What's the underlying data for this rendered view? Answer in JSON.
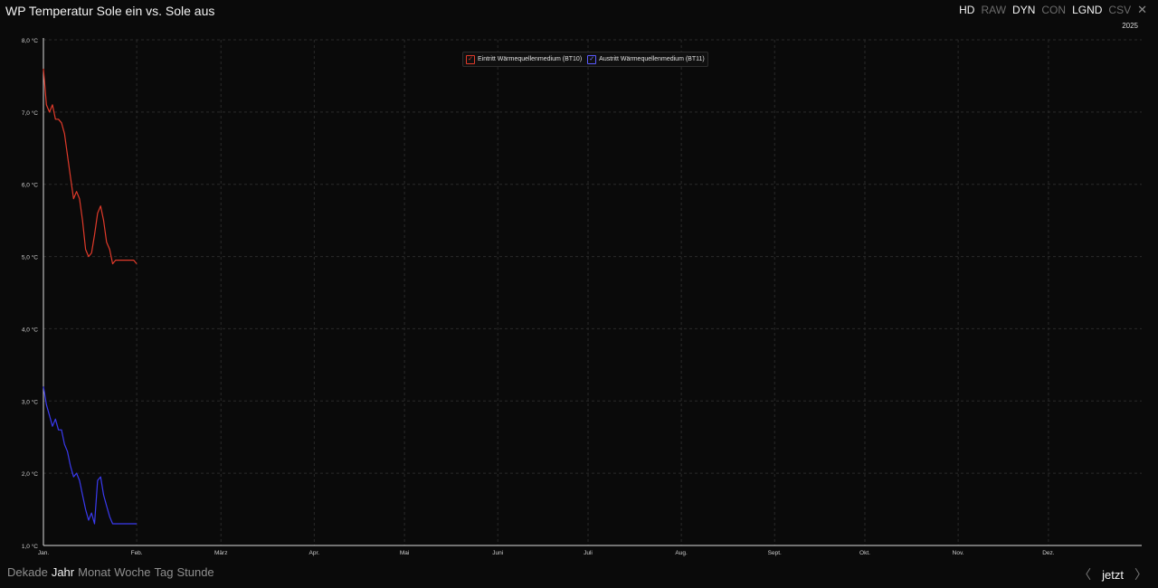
{
  "header": {
    "title": "WP Temperatur Sole ein vs. Sole aus",
    "toolbar": [
      {
        "label": "HD",
        "active": true
      },
      {
        "label": "RAW",
        "active": false
      },
      {
        "label": "DYN",
        "active": true
      },
      {
        "label": "CON",
        "active": false
      },
      {
        "label": "LGND",
        "active": true
      },
      {
        "label": "CSV",
        "active": false
      }
    ],
    "close_icon": "close-icon",
    "year": "2025"
  },
  "legend": [
    {
      "label": "Eintritt Wärmequellenmedium (BT10)",
      "color": "#e03a2a",
      "checked": true
    },
    {
      "label": "Austritt Wärmequellenmedium (BT11)",
      "color": "#3a3af0",
      "checked": true
    }
  ],
  "chart_data": {
    "type": "line",
    "ylim": [
      1.0,
      8.0
    ],
    "y_ticks": [
      "1,0 °C",
      "2,0 °C",
      "3,0 °C",
      "4,0 °C",
      "5,0 °C",
      "6,0 °C",
      "7,0 °C",
      "8,0 °C"
    ],
    "x_ticks": [
      "Jan.",
      "Feb.",
      "März",
      "Apr.",
      "Mai",
      "Juni",
      "Juli",
      "Aug.",
      "Sept.",
      "Okt.",
      "Nov.",
      "Dez."
    ],
    "x_unit": "day of year",
    "grid": true,
    "legend_position": "top-center",
    "series": [
      {
        "name": "Eintritt Wärmequellenmedium (BT10)",
        "color": "#e03a2a",
        "x": [
          1,
          2,
          3,
          4,
          5,
          6,
          7,
          8,
          9,
          10,
          11,
          12,
          13,
          14,
          15,
          16,
          17,
          18,
          19,
          20,
          21,
          22,
          23,
          24,
          25,
          26,
          27,
          28,
          29,
          30,
          31,
          32
        ],
        "y": [
          7.6,
          7.1,
          7.0,
          7.1,
          6.9,
          6.9,
          6.85,
          6.7,
          6.4,
          6.1,
          5.8,
          5.9,
          5.8,
          5.5,
          5.1,
          5.0,
          5.05,
          5.3,
          5.6,
          5.7,
          5.5,
          5.2,
          5.1,
          4.9,
          4.95,
          4.95,
          4.95,
          4.95,
          4.95,
          4.95,
          4.95,
          4.9
        ]
      },
      {
        "name": "Austritt Wärmequellenmedium (BT11)",
        "color": "#3a3af0",
        "x": [
          1,
          2,
          3,
          4,
          5,
          6,
          7,
          8,
          9,
          10,
          11,
          12,
          13,
          14,
          15,
          16,
          17,
          18,
          19,
          20,
          21,
          22,
          23,
          24,
          25,
          26,
          27,
          28,
          29,
          30,
          31,
          32
        ],
        "y": [
          3.2,
          2.95,
          2.8,
          2.65,
          2.75,
          2.6,
          2.6,
          2.4,
          2.3,
          2.1,
          1.95,
          2.0,
          1.9,
          1.7,
          1.5,
          1.35,
          1.45,
          1.3,
          1.9,
          1.95,
          1.7,
          1.55,
          1.4,
          1.3,
          1.3,
          1.3,
          1.3,
          1.3,
          1.3,
          1.3,
          1.3,
          1.3
        ]
      }
    ]
  },
  "footer": {
    "tabs": [
      {
        "label": "Dekade",
        "active": false
      },
      {
        "label": "Jahr",
        "active": true
      },
      {
        "label": "Monat",
        "active": false
      },
      {
        "label": "Woche",
        "active": false
      },
      {
        "label": "Tag",
        "active": false
      },
      {
        "label": "Stunde",
        "active": false
      }
    ],
    "now_label": "jetzt"
  }
}
